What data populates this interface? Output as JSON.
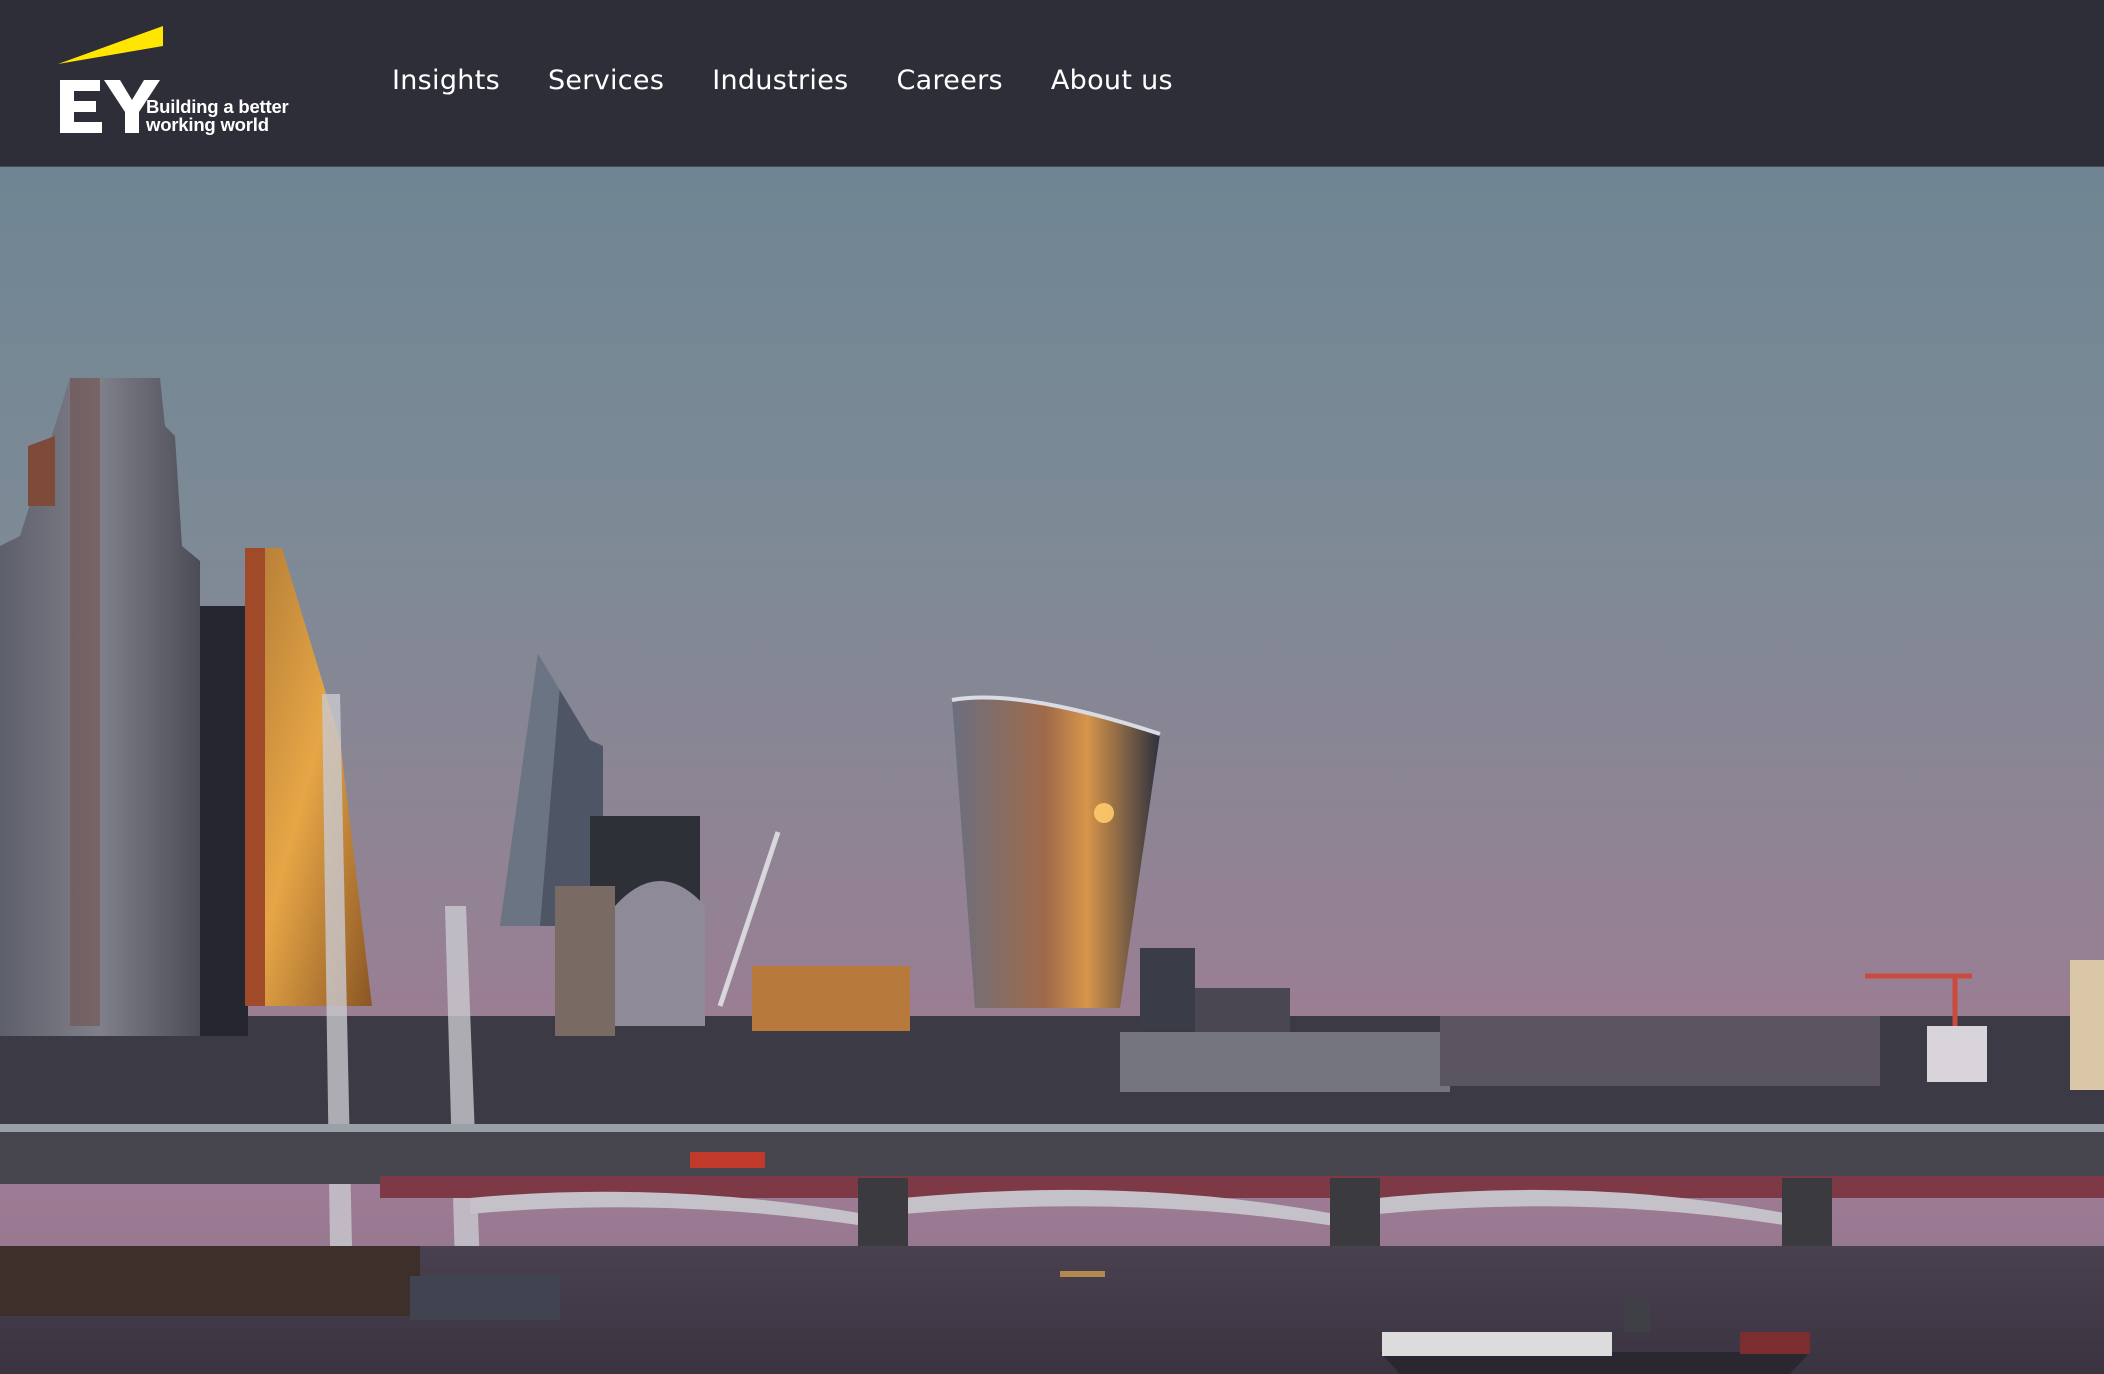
{
  "brand": {
    "logo_text": "EY",
    "tagline_line1": "Building a better",
    "tagline_line2": "working world",
    "accent_color": "#ffe600",
    "header_bg": "#2e2e38"
  },
  "nav": {
    "items": [
      {
        "label": "Insights"
      },
      {
        "label": "Services"
      },
      {
        "label": "Industries"
      },
      {
        "label": "Careers"
      },
      {
        "label": "About us"
      }
    ]
  },
  "hero": {
    "image": "london-skyline-dusk-thames-blackfriars-bridge"
  }
}
